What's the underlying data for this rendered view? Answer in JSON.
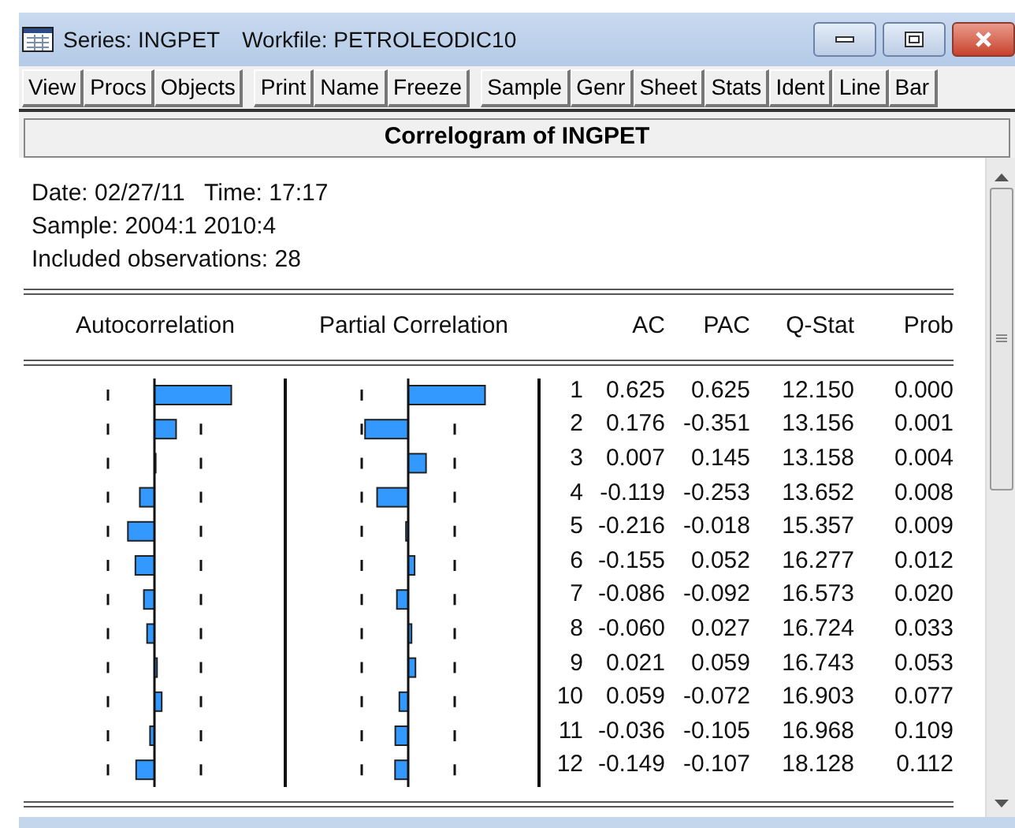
{
  "window": {
    "title": "Series: INGPET",
    "workfile": "Workfile: PETROLEODIC10"
  },
  "toolbar": [
    [
      "View",
      "Procs",
      "Objects"
    ],
    [
      "Print",
      "Name",
      "Freeze"
    ],
    [
      "Sample",
      "Genr",
      "Sheet",
      "Stats",
      "Ident",
      "Line",
      "Bar"
    ]
  ],
  "heading": "Correlogram of INGPET",
  "info": [
    "Date: 02/27/11   Time: 17:17",
    "Sample: 2004:1 2010:4",
    "Included observations: 28"
  ],
  "columns": [
    "Autocorrelation",
    "Partial Correlation",
    "AC",
    "PAC",
    "Q-Stat",
    "Prob"
  ],
  "rows": [
    {
      "lag": "1",
      "ac": "0.625",
      "pac": "0.625",
      "q_stat": "12.150",
      "prob": "0.000"
    },
    {
      "lag": "2",
      "ac": "0.176",
      "pac": "-0.351",
      "q_stat": "13.156",
      "prob": "0.001"
    },
    {
      "lag": "3",
      "ac": "0.007",
      "pac": "0.145",
      "q_stat": "13.158",
      "prob": "0.004"
    },
    {
      "lag": "4",
      "ac": "-0.119",
      "pac": "-0.253",
      "q_stat": "13.652",
      "prob": "0.008"
    },
    {
      "lag": "5",
      "ac": "-0.216",
      "pac": "-0.018",
      "q_stat": "15.357",
      "prob": "0.009"
    },
    {
      "lag": "6",
      "ac": "-0.155",
      "pac": "0.052",
      "q_stat": "16.277",
      "prob": "0.012"
    },
    {
      "lag": "7",
      "ac": "-0.086",
      "pac": "-0.092",
      "q_stat": "16.573",
      "prob": "0.020"
    },
    {
      "lag": "8",
      "ac": "-0.060",
      "pac": "0.027",
      "q_stat": "16.724",
      "prob": "0.033"
    },
    {
      "lag": "9",
      "ac": "0.021",
      "pac": "0.059",
      "q_stat": "16.743",
      "prob": "0.053"
    },
    {
      "lag": "10",
      "ac": "0.059",
      "pac": "-0.072",
      "q_stat": "16.903",
      "prob": "0.077"
    },
    {
      "lag": "11",
      "ac": "-0.036",
      "pac": "-0.105",
      "q_stat": "16.968",
      "prob": "0.109"
    },
    {
      "lag": "12",
      "ac": "-0.149",
      "pac": "-0.107",
      "q_stat": "18.128",
      "prob": "0.112"
    }
  ]
}
